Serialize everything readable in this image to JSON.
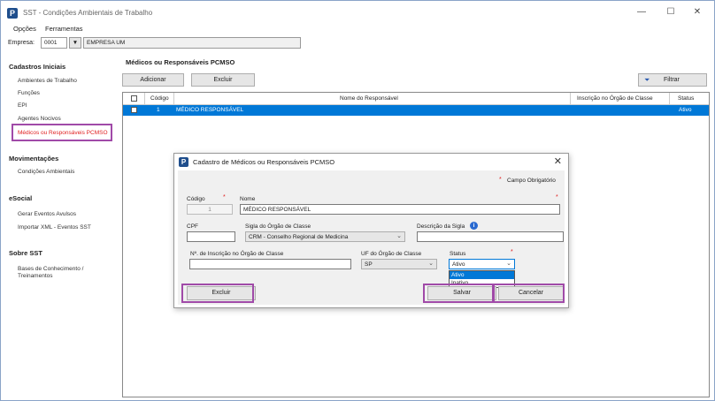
{
  "window": {
    "title": "SST - Condições Ambientais de Trabalho",
    "app_icon": "P"
  },
  "window_controls": {
    "minimize": "—",
    "maximize": "☐",
    "close": "✕"
  },
  "menu": {
    "items": [
      "Opções",
      "Ferramentas"
    ]
  },
  "company": {
    "label": "Empresa:",
    "code": "0001",
    "dropdown_icon": "▼",
    "name": "EMPRESA UM"
  },
  "sidebar": {
    "sections": [
      {
        "title": "Cadastros Iniciais",
        "items": [
          "Ambientes de Trabalho",
          "Funções",
          "EPI",
          "Agentes Nocivos",
          "Médicos ou Responsáveis PCMSO"
        ]
      },
      {
        "title": "Movimentações",
        "items": [
          "Condições Ambientais"
        ]
      },
      {
        "title": "eSocial",
        "items": [
          "Gerar Eventos Avulsos",
          "Importar XML - Eventos SST"
        ]
      },
      {
        "title": "Sobre SST",
        "items": [
          "Bases de Conhecimento /",
          "Treinamentos"
        ]
      }
    ],
    "active_item": "Médicos ou Responsáveis PCMSO",
    "active_color": "#e02020"
  },
  "main": {
    "title": "Médicos ou Responsáveis PCMSO",
    "buttons": {
      "add": "Adicionar",
      "delete": "Excluir",
      "filter": "Filtrar"
    },
    "grid": {
      "columns": [
        "Código",
        "Nome do Responsável",
        "Inscrição no Órgão de Classe",
        "Status"
      ],
      "rows": [
        {
          "code": "1",
          "name": "MÉDICO RESPONSÁVEL",
          "registration": "",
          "status": "Ativo"
        }
      ],
      "selected_color": "#0078d7"
    }
  },
  "dialog": {
    "title": "Cadastro de Médicos ou Responsáveis PCMSO",
    "close": "✕",
    "required_marker": "*",
    "required_note": "Campo Obrigatório",
    "fields": {
      "code": {
        "label": "Código",
        "value": "1"
      },
      "name": {
        "label": "Nome",
        "value": "MÉDICO RESPONSÁVEL"
      },
      "cpf": {
        "label": "CPF",
        "value": ""
      },
      "class_org": {
        "label": "Sigla do Órgão de Classe",
        "value": "CRM - Conselho Regional de Medicina"
      },
      "class_org_desc": {
        "label": "Descrição da Sigla",
        "value": ""
      },
      "registration": {
        "label": "Nº. de Inscrição no Órgão de Classe",
        "value": ""
      },
      "uf": {
        "label": "UF do Órgão de Classe",
        "value": "SP"
      },
      "status": {
        "label": "Status",
        "value": "Ativo",
        "options": [
          "Ativo",
          "Inativo"
        ]
      }
    },
    "buttons": {
      "delete": "Excluir",
      "save": "Salvar",
      "cancel": "Cancelar"
    }
  },
  "highlight_color": "#a04aa8"
}
